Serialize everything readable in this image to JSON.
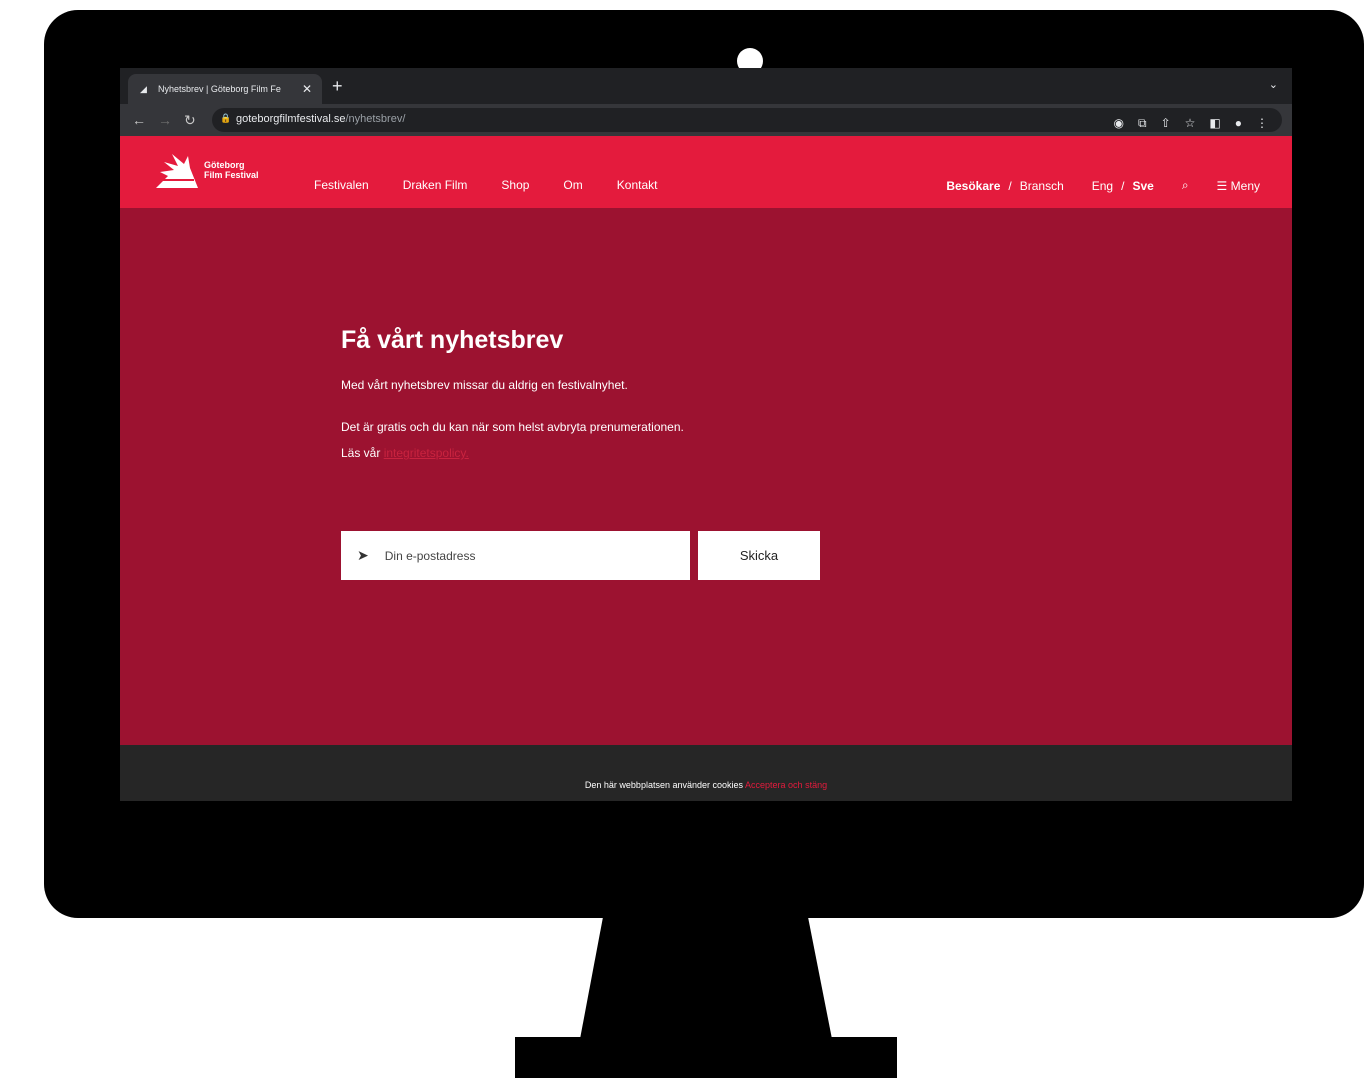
{
  "browser": {
    "tab_title": "Nyhetsbrev | Göteborg Film Fe",
    "new_tab": "+",
    "url_host": "goteborgfilmfestival.se",
    "url_path": "/nyhetsbrev/"
  },
  "site": {
    "logo_line1": "Göteborg",
    "logo_line2": "Film Festival",
    "nav": [
      "Festivalen",
      "Draken Film",
      "Shop",
      "Om",
      "Kontakt"
    ],
    "audience": {
      "visitor": "Besökare",
      "sep": "/",
      "industry": "Bransch"
    },
    "language": {
      "eng": "Eng",
      "sep": "/",
      "sve": "Sve"
    },
    "menu_label": "Meny"
  },
  "newsletter": {
    "heading": "Få vårt nyhetsbrev",
    "intro": "Med vårt nyhetsbrev missar du aldrig en festivalnyhet.",
    "free_text": "Det är gratis och du kan när som helst avbryta prenumerationen.",
    "policy_prefix": "Läs vår",
    "policy_link": "integritetspolicy.",
    "email_placeholder": "Din e-postadress",
    "submit_label": "Skicka"
  },
  "cookie": {
    "text": "Den här webbplatsen använder cookies",
    "accept": "Acceptera och stäng"
  }
}
